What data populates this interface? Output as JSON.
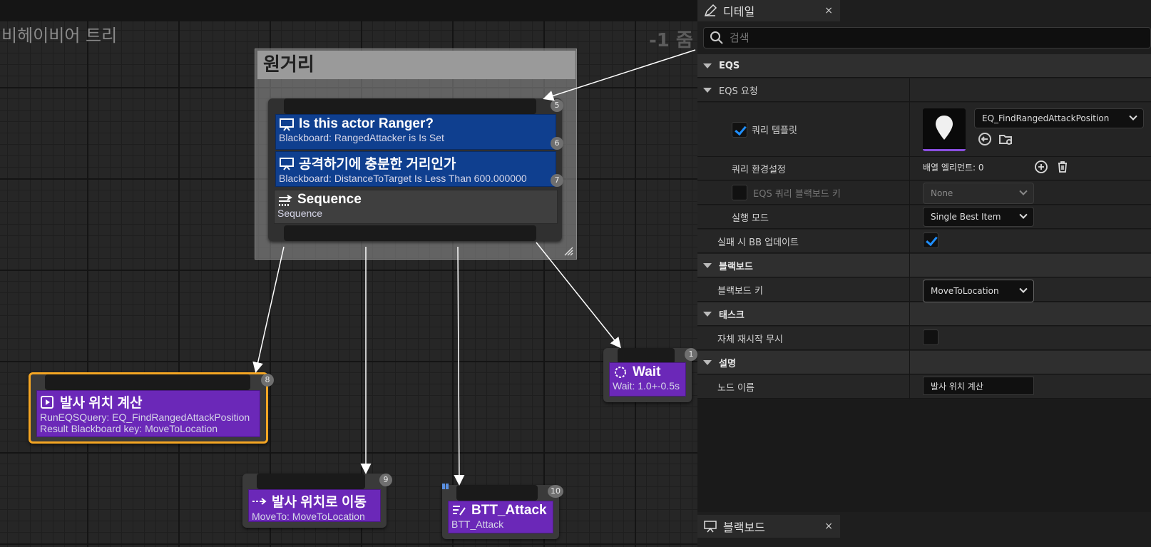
{
  "graph": {
    "title": "비헤이비어 트리",
    "zoom": "-1 줌",
    "comment_title": "원거리",
    "selector_badge": "5",
    "decorators": [
      {
        "title": "Is this actor Ranger?",
        "subtitle": "Blackboard: RangedAttacker is Is Set",
        "badge": "6"
      },
      {
        "title": "공격하기에 충분한 거리인가",
        "subtitle": "Blackboard: DistanceToTarget Is Less Than 600.000000",
        "badge": "7"
      }
    ],
    "sequence": {
      "title": "Sequence",
      "subtitle": "Sequence"
    },
    "eqs_node": {
      "title": "발사 위치 계산",
      "line1": "RunEQSQuery: EQ_FindRangedAttackPosition",
      "line2": "Result Blackboard key: MoveToLocation",
      "badge": "8"
    },
    "move_node": {
      "title": "발사 위치로 이동",
      "subtitle": "MoveTo: MoveToLocation",
      "badge": "9"
    },
    "attack_node": {
      "title": "BTT_Attack",
      "subtitle": "BTT_Attack",
      "badge": "10"
    },
    "wait_node": {
      "title": "Wait",
      "subtitle": "Wait: 1.0+-0.5s",
      "badge": "1"
    }
  },
  "details": {
    "tab_label": "디테일",
    "close": "×",
    "search_placeholder": "검색",
    "sections": {
      "eqs": "EQS",
      "eqs_request": "EQS 요청",
      "query_template": "쿼리 템플릿",
      "query_template_value": "EQ_FindRangedAttackPosition",
      "query_config": "쿼리 환경설정",
      "query_config_value": "배열 엘리먼트: 0",
      "eqs_bb_key": "EQS 쿼리 블랙보드 키",
      "eqs_bb_key_value": "None",
      "run_mode": "실행 모드",
      "run_mode_value": "Single Best Item",
      "update_bb_on_fail": "실패 시 BB 업데이트",
      "blackboard": "블랙보드",
      "blackboard_key": "블랙보드 키",
      "blackboard_key_value": "MoveToLocation",
      "task": "태스크",
      "ignore_restart_self": "자체 재시작 무시",
      "description": "설명",
      "node_name": "노드 이름",
      "node_name_value": "발사 위치 계산"
    },
    "bottom_tab_label": "블랙보드"
  },
  "colors": {
    "decorator_blue": "#0f3f8f",
    "task_purple": "#6b28b8",
    "selected_orange": "#f5a623",
    "checkbox_blue": "#1f8fff"
  }
}
